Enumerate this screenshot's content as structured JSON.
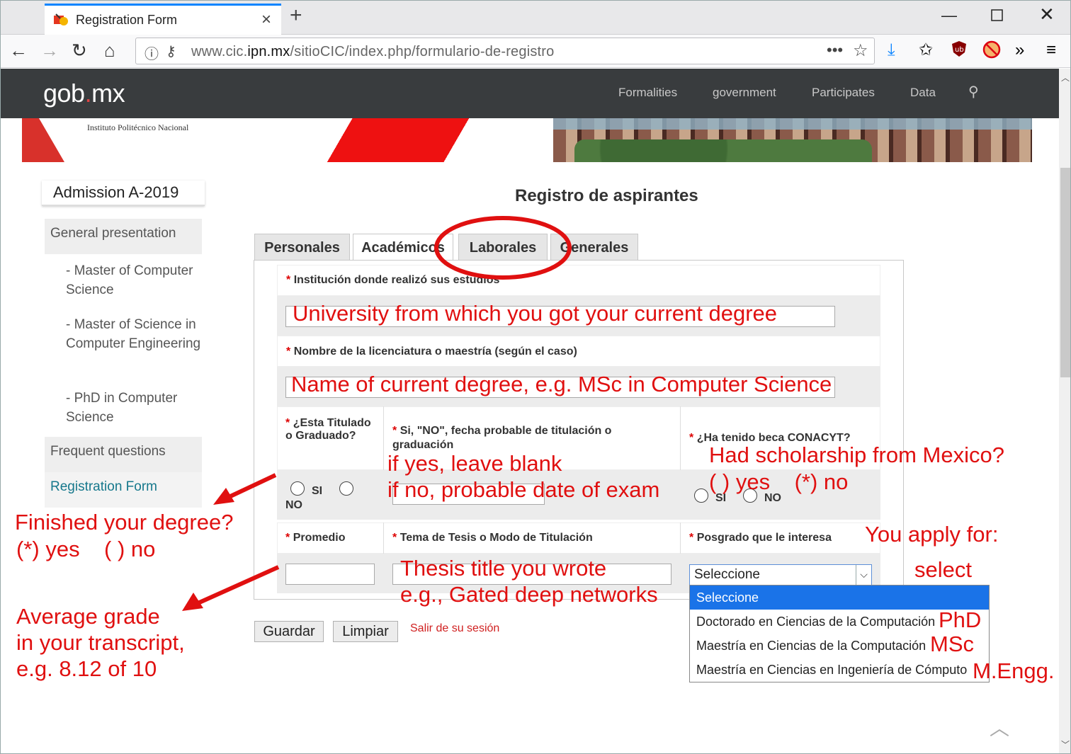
{
  "browser": {
    "tab_title": "Registration Form",
    "url_host_pre": "www.cic.",
    "url_host_bold": "ipn.mx",
    "url_path": "/sitioCIC/index.php/formulario-de-registro",
    "more": "•••"
  },
  "gob": {
    "logo_pre": "gob",
    "logo_dot": ".",
    "logo_post": "mx",
    "nav": [
      "Formalities",
      "government",
      "Participates",
      "Data"
    ]
  },
  "banner": {
    "institute": "Instituto Politécnico Nacional"
  },
  "sidebar": {
    "title": "Admission A-2019",
    "general": "General presentation",
    "programs": [
      "- Master of Computer Science",
      "- Master of Science in Computer Engineering",
      "- PhD in Computer Science"
    ],
    "faq": "Frequent questions",
    "registration": "Registration Form"
  },
  "form": {
    "title": "Registro de aspirantes",
    "tabs": [
      "Personales",
      "Académicos",
      "Laborales",
      "Generales"
    ],
    "institution_label": "Institución donde realizó sus estudios",
    "degree_name_label": "Nombre de la licenciatura o maestría (según el caso)",
    "titulado_label": "¿Esta Titulado o Graduado?",
    "fecha_label": "Si, \"NO\", fecha probable de titulación o graduación",
    "beca_label": "¿Ha tenido beca CONACYT?",
    "si": "SI",
    "no": "NO",
    "promedio_label": "Promedio",
    "tesis_label": "Tema de Tesis o Modo de Titulación",
    "posgrado_label": "Posgrado que le interesa",
    "select_value": "Seleccione",
    "options": [
      "Seleccione",
      "Doctorado en Ciencias de la Computación",
      "Maestría en Ciencias de la Computación",
      "Maestría en Ciencias en Ingeniería de Cómputo"
    ],
    "star": "*",
    "save": "Guardar",
    "clear": "Limpiar",
    "logout": "Salir de su sesión"
  },
  "annotations": {
    "university": "University from which you got your current degree",
    "degree": "Name of current degree, e.g. MSc in Computer Science",
    "if_yes": "if yes, leave blank",
    "if_no": "if no, probable date of exam",
    "scholarship": "Had scholarship from Mexico?",
    "scholarship_opts": "( ) yes    (*) no",
    "finished": "Finished your degree?",
    "finished_opts": "(*) yes    ( ) no",
    "apply": "You apply for:",
    "select": "select",
    "thesis": "Thesis title you wrote",
    "thesis_eg": "e.g., Gated deep networks",
    "avg1": "Average grade",
    "avg2": "in your transcript,",
    "avg3": "e.g. 8.12 of 10",
    "phd": "PhD",
    "msc": "MSc",
    "meng": "M.Engg."
  },
  "colors": {
    "accent": "#e01010",
    "gobbar": "#393c3e",
    "link": "#16788c",
    "select": "#1a73e8"
  }
}
